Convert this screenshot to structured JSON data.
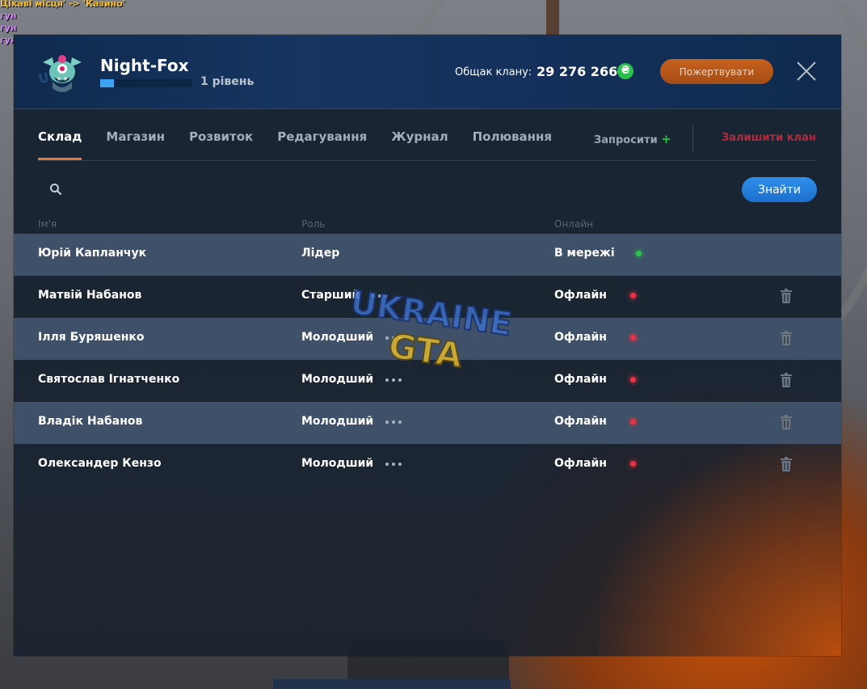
{
  "chat": {
    "lines": [
      "Цікаві місця' -> 'Казино'",
      "гун",
      "гун",
      "гун"
    ]
  },
  "header": {
    "clan_name": "Night-Fox",
    "level_progress_fraction": 0.15,
    "level_text": "1 рівень",
    "balance_label": "Общак клану:",
    "balance_value": "29 276 266",
    "currency_symbol": "₴",
    "donate_label": "Пожертвувати"
  },
  "tabs": [
    {
      "label": "Склад",
      "active": true
    },
    {
      "label": "Магазин",
      "active": false
    },
    {
      "label": "Розвиток",
      "active": false
    },
    {
      "label": "Редагування",
      "active": false
    },
    {
      "label": "Журнал",
      "active": false
    },
    {
      "label": "Полювання",
      "active": false
    }
  ],
  "actions": {
    "invite_label": "Запросити",
    "invite_plus": "+",
    "leave_label": "Залишити клан"
  },
  "search": {
    "placeholder": "",
    "value": "",
    "button_label": "Знайти"
  },
  "table": {
    "headers": {
      "name": "Ім'я",
      "role": "Роль",
      "online": "Онлайн"
    },
    "rows": [
      {
        "name": "Юрій Капланчук",
        "role": "Лідер",
        "status": "В мережі",
        "online": true,
        "highlight": true,
        "menu": false,
        "deletable": false
      },
      {
        "name": "Матвій Набанов",
        "role": "Старший",
        "status": "Офлайн",
        "online": false,
        "highlight": false,
        "menu": true,
        "deletable": true
      },
      {
        "name": "Ілля Буряшенко",
        "role": "Молодший",
        "status": "Офлайн",
        "online": false,
        "highlight": true,
        "menu": true,
        "deletable": true
      },
      {
        "name": "Святослав Ігнатченко",
        "role": "Молодший",
        "status": "Офлайн",
        "online": false,
        "highlight": false,
        "menu": true,
        "deletable": true
      },
      {
        "name": "Владік Набанов",
        "role": "Молодший",
        "status": "Офлайн",
        "online": false,
        "highlight": true,
        "menu": true,
        "deletable": true
      },
      {
        "name": "Олександер Кензо",
        "role": "Молодший",
        "status": "Офлайн",
        "online": false,
        "highlight": false,
        "menu": true,
        "deletable": true
      }
    ]
  },
  "watermark": {
    "line1": "UKRAINE",
    "line2": "GTA"
  },
  "colors": {
    "accent_orange": "#e07a3d",
    "online_green": "#26c94a",
    "offline_red": "#e83345",
    "button_blue": "#2f8fe8",
    "leave_red": "#b52a3a"
  }
}
